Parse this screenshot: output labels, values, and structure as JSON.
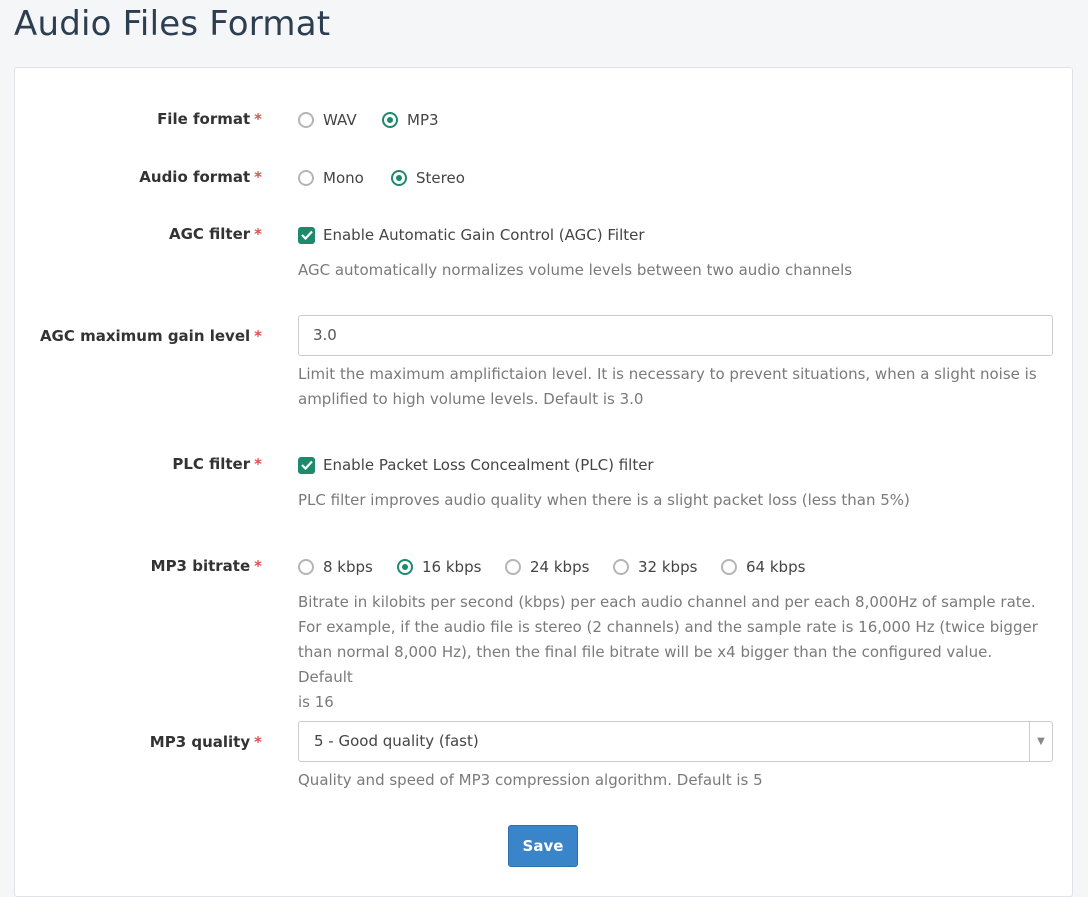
{
  "page": {
    "title": "Audio Files Format"
  },
  "form": {
    "required_mark": "*",
    "file_format": {
      "label": "File format",
      "options": [
        "WAV",
        "MP3"
      ],
      "selected": "MP3"
    },
    "audio_format": {
      "label": "Audio format",
      "options": [
        "Mono",
        "Stereo"
      ],
      "selected": "Stereo"
    },
    "agc_filter": {
      "label": "AGC filter",
      "checkbox_label": "Enable Automatic Gain Control (AGC) Filter",
      "checked": true,
      "help": "AGC automatically normalizes volume levels between two audio channels"
    },
    "agc_gain": {
      "label": "AGC maximum gain level",
      "value": "3.0",
      "help_line1": "Limit the maximum amplifictaion level. It is necessary to prevent situations, when a slight noise is",
      "help_line2": "amplified to high volume levels. Default is 3.0"
    },
    "plc_filter": {
      "label": "PLC filter",
      "checkbox_label": "Enable Packet Loss Concealment (PLC) filter",
      "checked": true,
      "help": "PLC filter improves audio quality when there is a slight packet loss (less than 5%)"
    },
    "mp3_bitrate": {
      "label": "MP3 bitrate",
      "options": [
        "8 kbps",
        "16 kbps",
        "24 kbps",
        "32 kbps",
        "64 kbps"
      ],
      "selected": "16 kbps",
      "help_line1": "Bitrate in kilobits per second (kbps) per each audio channel and per each 8,000Hz of sample rate.",
      "help_line2": "For example, if the audio file is stereo (2 channels) and the sample rate is 16,000 Hz (twice bigger",
      "help_line3": "than normal 8,000 Hz), then the final file bitrate will be x4 bigger than the configured value. Default",
      "help_line4": "is 16"
    },
    "mp3_quality": {
      "label": "MP3 quality",
      "selected": "5 - Good quality (fast)",
      "help": "Quality and speed of MP3 compression algorithm. Default is 5"
    },
    "save_label": "Save"
  },
  "colors": {
    "accent": "#1d8a6e",
    "required": "#d9534f",
    "button": "#3a84c9"
  }
}
